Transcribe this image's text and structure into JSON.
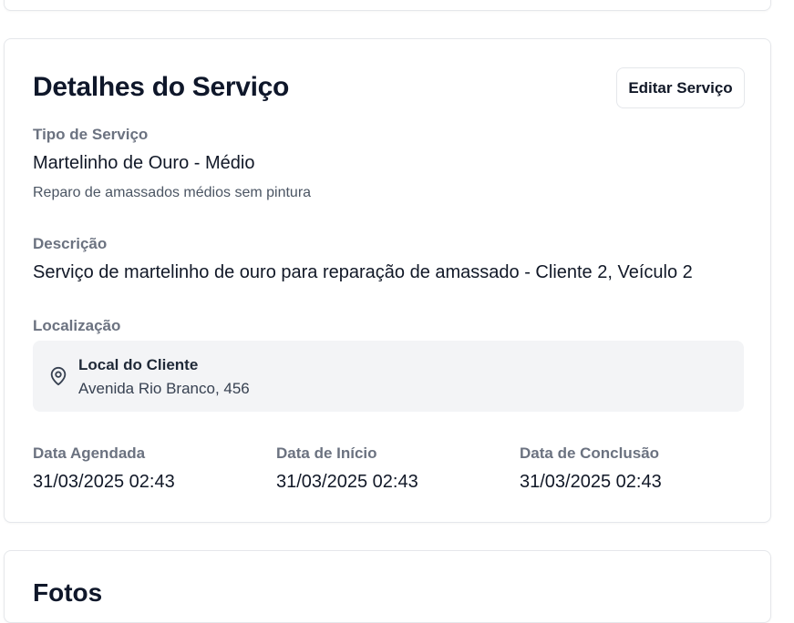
{
  "service": {
    "title": "Detalhes do Serviço",
    "edit_label": "Editar Serviço",
    "type_label": "Tipo de Serviço",
    "type_value": "Martelinho de Ouro - Médio",
    "type_description": "Reparo de amassados médios sem pintura",
    "description_label": "Descrição",
    "description_value": "Serviço de martelinho de ouro para reparação de amassado - Cliente 2, Veículo 2",
    "location_label": "Localização",
    "location": {
      "icon": "map-pin-icon",
      "name": "Local do Cliente",
      "address": "Avenida Rio Branco, 456"
    },
    "dates": [
      {
        "label": "Data Agendada",
        "value": "31/03/2025 02:43"
      },
      {
        "label": "Data de Início",
        "value": "31/03/2025 02:43"
      },
      {
        "label": "Data de Conclusão",
        "value": "31/03/2025 02:43"
      }
    ]
  },
  "next_section": {
    "title": "Fotos"
  },
  "colors": {
    "label_gray": "#6b7280",
    "location_bg": "#f3f4f6",
    "border": "#e5e7eb"
  }
}
